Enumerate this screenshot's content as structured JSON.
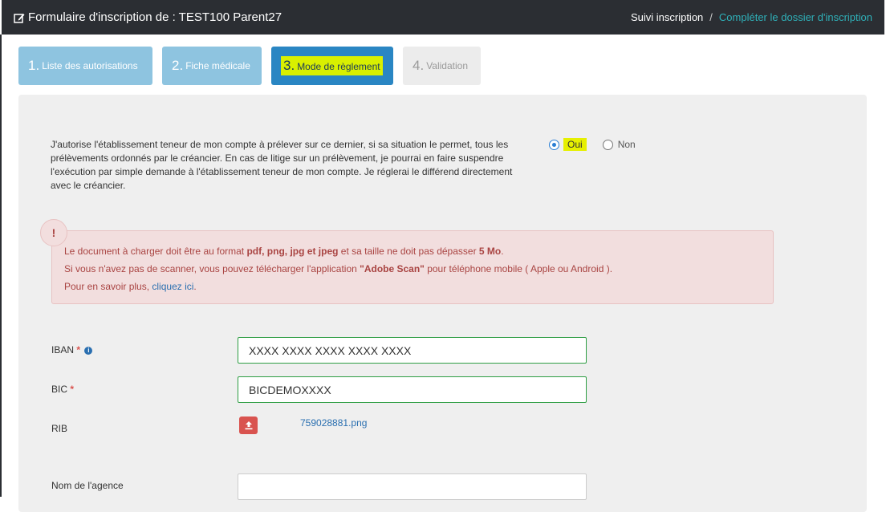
{
  "header": {
    "title": "Formulaire d'inscription de : TEST100 Parent27",
    "breadcrumb": [
      {
        "label": "Suivi inscription"
      },
      {
        "label": "Compléter le dossier d'inscription"
      }
    ],
    "separator": "/"
  },
  "steps": [
    {
      "num": "1.",
      "label": "Liste des autorisations",
      "state": "done"
    },
    {
      "num": "2.",
      "label": "Fiche médicale",
      "state": "done"
    },
    {
      "num": "3.",
      "label": "Mode de règlement",
      "state": "active"
    },
    {
      "num": "4.",
      "label": "Validation",
      "state": "disabled"
    }
  ],
  "authorization": {
    "text": "J'autorise l'établissement teneur de mon compte à prélever sur ce dernier, si sa situation le permet, tous les prélèvements ordonnés par le créancier. En cas de litige sur un prélèvement, je pourrai en faire suspendre l'exécution par simple demande à l'établissement teneur de mon compte. Je réglerai le différend directement avec le créancier.",
    "options": [
      {
        "label": "Oui",
        "checked": true
      },
      {
        "label": "Non",
        "checked": false
      }
    ]
  },
  "alert": {
    "icon": "!",
    "line1_a": "Le document à charger doit être au format ",
    "line1_b": "pdf, png, jpg et jpeg",
    "line1_c": " et sa taille ne doit pas dépasser ",
    "line1_d": "5 Mo",
    "line1_e": ".",
    "line2_a": "Si vous n'avez pas de scanner, vous pouvez télécharger l'application ",
    "line2_b": "\"Adobe Scan\"",
    "line2_c": " pour téléphone mobile ( Apple ou Android ).",
    "line3_a": "Pour en savoir plus, ",
    "line3_link": "cliquez ici",
    "line3_b": "."
  },
  "form": {
    "iban": {
      "label": "IBAN",
      "required": "*",
      "value": "XXXX XXXX XXXX XXXX XXXX"
    },
    "bic": {
      "label": "BIC",
      "required": "*",
      "value": "BICDEMOXXXX"
    },
    "rib": {
      "label": "RIB",
      "file": "759028881.png"
    },
    "agence": {
      "label": "Nom de l'agence",
      "value": ""
    }
  },
  "colors": {
    "topbar": "#2b2e33",
    "step_done": "#8ec4e0",
    "step_active": "#2a86c3",
    "highlight": "#d9f000",
    "alert_bg": "#f2dede",
    "valid_border": "#2f9e44"
  }
}
